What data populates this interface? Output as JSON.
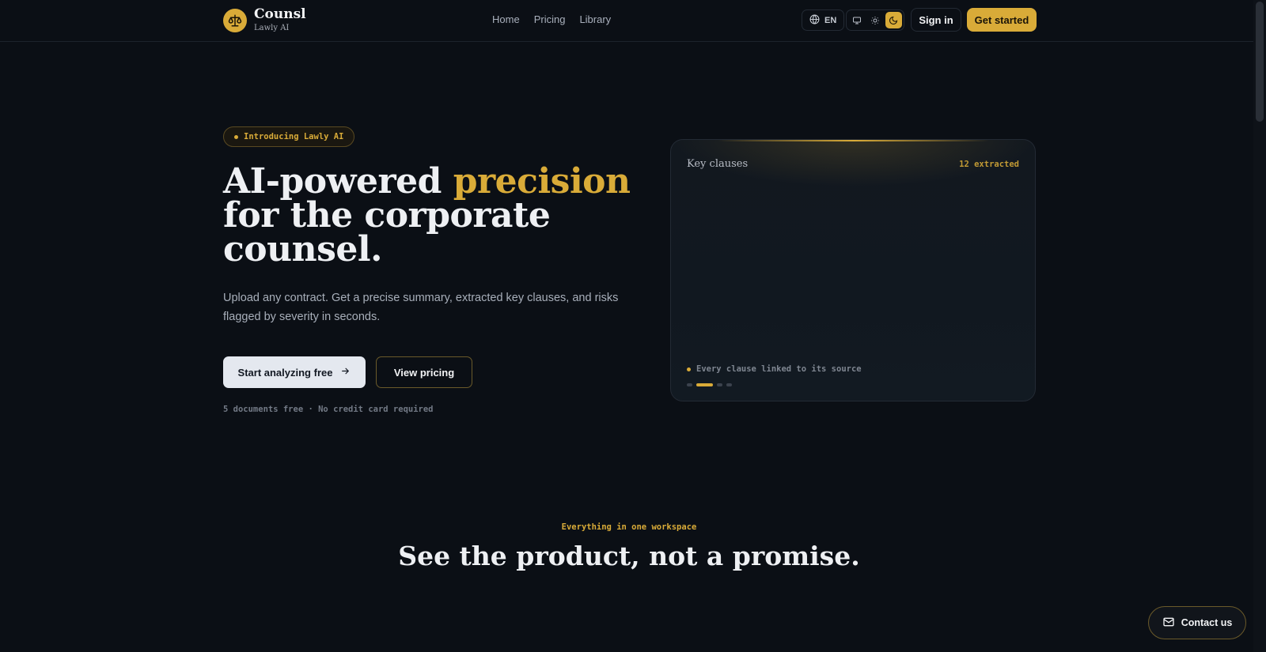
{
  "brand": {
    "name": "Counsl",
    "subtitle": "Lawly AI"
  },
  "nav": {
    "items": [
      "Home",
      "Pricing",
      "Library"
    ]
  },
  "header": {
    "language": "EN",
    "theme_options": [
      "monitor-icon",
      "sun-icon",
      "moon-icon"
    ],
    "theme_active": "moon-icon",
    "signin_label": "Sign in",
    "getstarted_label": "Get started"
  },
  "hero": {
    "badge": "Introducing Lawly AI",
    "title_part1": "AI-powered ",
    "title_accent": "precision",
    "title_part2": " for the corporate counsel.",
    "description": "Upload any contract. Get a precise summary, extracted key clauses, and risks flagged by severity in seconds.",
    "primary_cta": "Start analyzing free",
    "secondary_cta": "View pricing",
    "note": "5 documents free · No credit card required"
  },
  "card": {
    "title": "Key clauses",
    "count": "12 extracted",
    "caption": "Every clause linked to its source",
    "dots": 4,
    "active_dot": 1
  },
  "section": {
    "eyebrow": "Everything in one workspace",
    "title": "See the product, not a promise."
  },
  "contact": {
    "label": "Contact us"
  },
  "colors": {
    "accent": "#d9ab38",
    "background": "#0b0f15",
    "text": "#eef0f3"
  }
}
